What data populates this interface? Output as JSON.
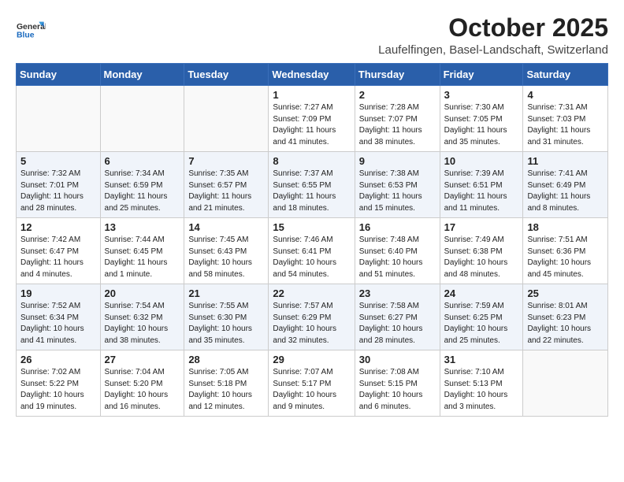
{
  "header": {
    "logo_general": "General",
    "logo_blue": "Blue",
    "month": "October 2025",
    "location": "Laufelfingen, Basel-Landschaft, Switzerland"
  },
  "days_of_week": [
    "Sunday",
    "Monday",
    "Tuesday",
    "Wednesday",
    "Thursday",
    "Friday",
    "Saturday"
  ],
  "weeks": [
    [
      {
        "day": "",
        "info": ""
      },
      {
        "day": "",
        "info": ""
      },
      {
        "day": "",
        "info": ""
      },
      {
        "day": "1",
        "info": "Sunrise: 7:27 AM\nSunset: 7:09 PM\nDaylight: 11 hours\nand 41 minutes."
      },
      {
        "day": "2",
        "info": "Sunrise: 7:28 AM\nSunset: 7:07 PM\nDaylight: 11 hours\nand 38 minutes."
      },
      {
        "day": "3",
        "info": "Sunrise: 7:30 AM\nSunset: 7:05 PM\nDaylight: 11 hours\nand 35 minutes."
      },
      {
        "day": "4",
        "info": "Sunrise: 7:31 AM\nSunset: 7:03 PM\nDaylight: 11 hours\nand 31 minutes."
      }
    ],
    [
      {
        "day": "5",
        "info": "Sunrise: 7:32 AM\nSunset: 7:01 PM\nDaylight: 11 hours\nand 28 minutes."
      },
      {
        "day": "6",
        "info": "Sunrise: 7:34 AM\nSunset: 6:59 PM\nDaylight: 11 hours\nand 25 minutes."
      },
      {
        "day": "7",
        "info": "Sunrise: 7:35 AM\nSunset: 6:57 PM\nDaylight: 11 hours\nand 21 minutes."
      },
      {
        "day": "8",
        "info": "Sunrise: 7:37 AM\nSunset: 6:55 PM\nDaylight: 11 hours\nand 18 minutes."
      },
      {
        "day": "9",
        "info": "Sunrise: 7:38 AM\nSunset: 6:53 PM\nDaylight: 11 hours\nand 15 minutes."
      },
      {
        "day": "10",
        "info": "Sunrise: 7:39 AM\nSunset: 6:51 PM\nDaylight: 11 hours\nand 11 minutes."
      },
      {
        "day": "11",
        "info": "Sunrise: 7:41 AM\nSunset: 6:49 PM\nDaylight: 11 hours\nand 8 minutes."
      }
    ],
    [
      {
        "day": "12",
        "info": "Sunrise: 7:42 AM\nSunset: 6:47 PM\nDaylight: 11 hours\nand 4 minutes."
      },
      {
        "day": "13",
        "info": "Sunrise: 7:44 AM\nSunset: 6:45 PM\nDaylight: 11 hours\nand 1 minute."
      },
      {
        "day": "14",
        "info": "Sunrise: 7:45 AM\nSunset: 6:43 PM\nDaylight: 10 hours\nand 58 minutes."
      },
      {
        "day": "15",
        "info": "Sunrise: 7:46 AM\nSunset: 6:41 PM\nDaylight: 10 hours\nand 54 minutes."
      },
      {
        "day": "16",
        "info": "Sunrise: 7:48 AM\nSunset: 6:40 PM\nDaylight: 10 hours\nand 51 minutes."
      },
      {
        "day": "17",
        "info": "Sunrise: 7:49 AM\nSunset: 6:38 PM\nDaylight: 10 hours\nand 48 minutes."
      },
      {
        "day": "18",
        "info": "Sunrise: 7:51 AM\nSunset: 6:36 PM\nDaylight: 10 hours\nand 45 minutes."
      }
    ],
    [
      {
        "day": "19",
        "info": "Sunrise: 7:52 AM\nSunset: 6:34 PM\nDaylight: 10 hours\nand 41 minutes."
      },
      {
        "day": "20",
        "info": "Sunrise: 7:54 AM\nSunset: 6:32 PM\nDaylight: 10 hours\nand 38 minutes."
      },
      {
        "day": "21",
        "info": "Sunrise: 7:55 AM\nSunset: 6:30 PM\nDaylight: 10 hours\nand 35 minutes."
      },
      {
        "day": "22",
        "info": "Sunrise: 7:57 AM\nSunset: 6:29 PM\nDaylight: 10 hours\nand 32 minutes."
      },
      {
        "day": "23",
        "info": "Sunrise: 7:58 AM\nSunset: 6:27 PM\nDaylight: 10 hours\nand 28 minutes."
      },
      {
        "day": "24",
        "info": "Sunrise: 7:59 AM\nSunset: 6:25 PM\nDaylight: 10 hours\nand 25 minutes."
      },
      {
        "day": "25",
        "info": "Sunrise: 8:01 AM\nSunset: 6:23 PM\nDaylight: 10 hours\nand 22 minutes."
      }
    ],
    [
      {
        "day": "26",
        "info": "Sunrise: 7:02 AM\nSunset: 5:22 PM\nDaylight: 10 hours\nand 19 minutes."
      },
      {
        "day": "27",
        "info": "Sunrise: 7:04 AM\nSunset: 5:20 PM\nDaylight: 10 hours\nand 16 minutes."
      },
      {
        "day": "28",
        "info": "Sunrise: 7:05 AM\nSunset: 5:18 PM\nDaylight: 10 hours\nand 12 minutes."
      },
      {
        "day": "29",
        "info": "Sunrise: 7:07 AM\nSunset: 5:17 PM\nDaylight: 10 hours\nand 9 minutes."
      },
      {
        "day": "30",
        "info": "Sunrise: 7:08 AM\nSunset: 5:15 PM\nDaylight: 10 hours\nand 6 minutes."
      },
      {
        "day": "31",
        "info": "Sunrise: 7:10 AM\nSunset: 5:13 PM\nDaylight: 10 hours\nand 3 minutes."
      },
      {
        "day": "",
        "info": ""
      }
    ]
  ]
}
